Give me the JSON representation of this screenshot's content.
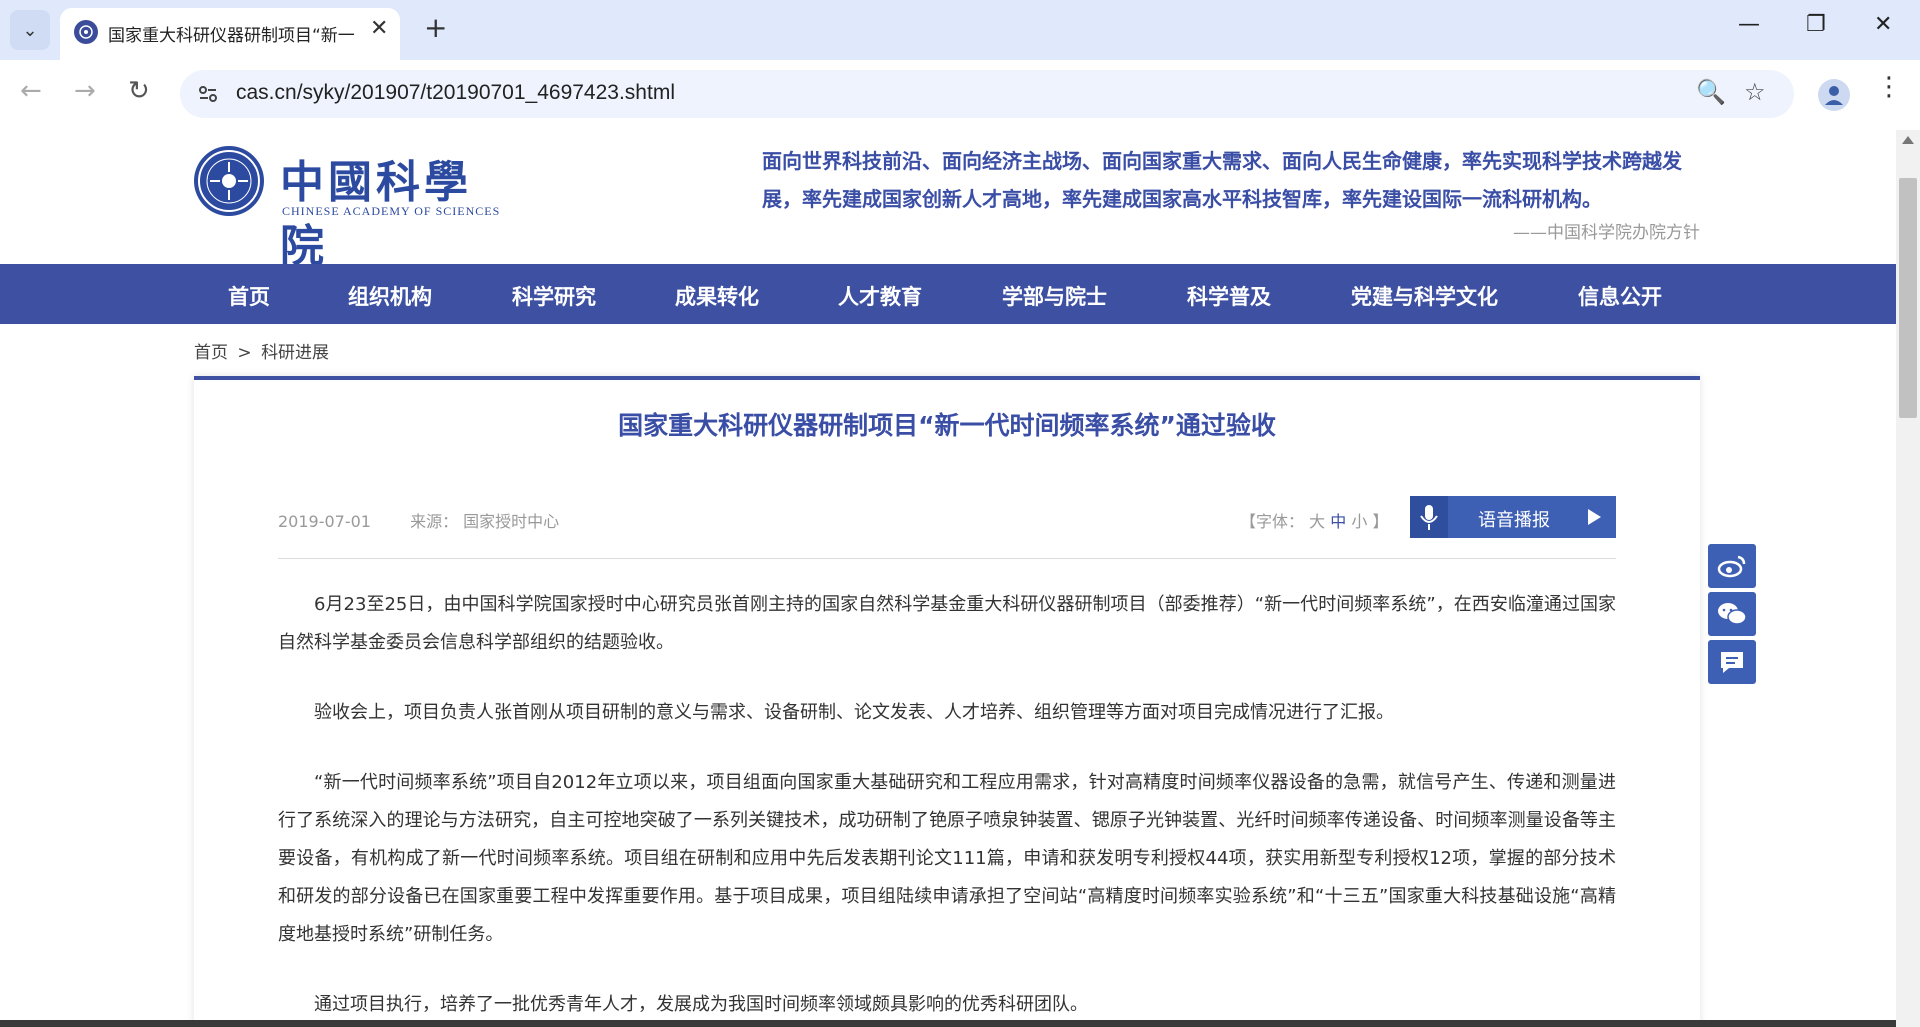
{
  "browser": {
    "tab_title": "国家重大科研仪器研制项目“新一",
    "url": "cas.cn/syky/201907/t20190701_4697423.shtml"
  },
  "header": {
    "logo_cn": "中國科學院",
    "logo_en": "CHINESE ACADEMY OF SCIENCES",
    "motto": "面向世界科技前沿、面向经济主战场、面向国家重大需求、面向人民生命健康，率先实现科学技术跨越发展，率先建成国家创新人才高地，率先建成国家高水平科技智库，率先建设国际一流科研机构。",
    "motto_source": "——中国科学院办院方针"
  },
  "nav": {
    "items": [
      "首页",
      "组织机构",
      "科学研究",
      "成果转化",
      "人才教育",
      "学部与院士",
      "科学普及",
      "党建与科学文化",
      "信息公开"
    ]
  },
  "breadcrumb": {
    "home": "首页",
    "sep": ">",
    "current": "科研进展"
  },
  "article": {
    "title": "国家重大科研仪器研制项目“新一代时间频率系统”通过验收",
    "date": "2019-07-01",
    "source": "来源：  国家授时中心",
    "font_label": "【字体：",
    "font_large": "大",
    "font_mid": "中",
    "font_small": "小",
    "font_end": "】",
    "speech_label": "语音播报",
    "paragraphs": [
      "6月23至25日，由中国科学院国家授时中心研究员张首刚主持的国家自然科学基金重大科研仪器研制项目（部委推荐）“新一代时间频率系统”，在西安临潼通过国家自然科学基金委员会信息科学部组织的结题验收。",
      "验收会上，项目负责人张首刚从项目研制的意义与需求、设备研制、论文发表、人才培养、组织管理等方面对项目完成情况进行了汇报。",
      "“新一代时间频率系统”项目自2012年立项以来，项目组面向国家重大基础研究和工程应用需求，针对高精度时间频率仪器设备的急需，就信号产生、传递和测量进行了系统深入的理论与方法研究，自主可控地突破了一系列关键技术，成功研制了铯原子喷泉钟装置、锶原子光钟装置、光纤时间频率传递设备、时间频率测量设备等主要设备，有机构成了新一代时间频率系统。项目组在研制和应用中先后发表期刊论文111篇，申请和获发明专利授权44项，获实用新型专利授权12项，掌握的部分技术和研发的部分设备已在国家重要工程中发挥重要作用。基于项目成果，项目组陆续申请承担了空间站“高精度时间频率实验系统”和“十三五”国家重大科技基础设施“高精度地基授时系统”研制任务。",
      "通过项目执行，培养了一批优秀青年人才，发展成为我国时间频率领域颇具影响的优秀科研团队。"
    ]
  }
}
